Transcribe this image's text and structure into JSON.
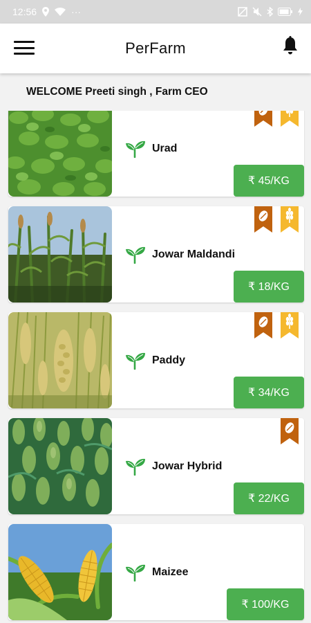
{
  "status_bar": {
    "time": "12:56",
    "dots": "···"
  },
  "app": {
    "title": "PerFarm"
  },
  "welcome": "WELCOME Preeti singh , Farm CEO",
  "colors": {
    "price_green": "#4caf50",
    "badge_brown": "#c0620e",
    "badge_gold": "#f5b82e",
    "leaf_green": "#35a845"
  },
  "crops": [
    {
      "name": "Urad",
      "price": "₹ 45/KG",
      "badges": [
        "brown",
        "gold"
      ],
      "image": "green-bean-field"
    },
    {
      "name": "Jowar Maldandi",
      "price": "₹ 18/KG",
      "badges": [
        "brown-seed-icon",
        "gold-wheat-icon"
      ],
      "image": "sorghum-field"
    },
    {
      "name": "Paddy",
      "price": "₹ 34/KG",
      "badges": [
        "brown-seed-icon",
        "gold-wheat-icon"
      ],
      "image": "paddy-field"
    },
    {
      "name": "Jowar Hybrid",
      "price": "₹ 22/KG",
      "badges": [
        "brown-seed-icon"
      ],
      "image": "sorghum-hybrid-field"
    },
    {
      "name": "Maizee",
      "price": "₹ 100/KG",
      "badges": [],
      "image": "corn-field"
    }
  ]
}
